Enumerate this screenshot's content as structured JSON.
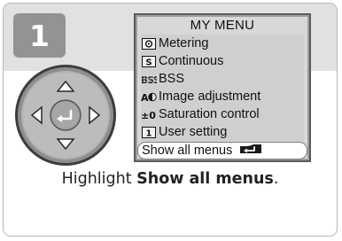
{
  "step": {
    "number": "1"
  },
  "menu": {
    "title": "MY MENU",
    "items": [
      {
        "label": "Metering",
        "icon": "metering-icon"
      },
      {
        "label": "Continuous",
        "icon": "continuous-icon"
      },
      {
        "label": "BSS",
        "icon": "bss-icon"
      },
      {
        "label": "Image adjustment",
        "icon": "image-adjustment-icon"
      },
      {
        "label": "Saturation control",
        "icon": "saturation-control-icon"
      },
      {
        "label": "User setting",
        "icon": "user-setting-icon"
      }
    ],
    "show_all": "Show all menus"
  },
  "caption": {
    "prefix": "Highlight ",
    "bold": "Show all menus",
    "suffix": "."
  },
  "colors": {
    "badge": "#939393",
    "header_band": "#e1e1e1",
    "lcd_frame": "#5a5a5a"
  }
}
